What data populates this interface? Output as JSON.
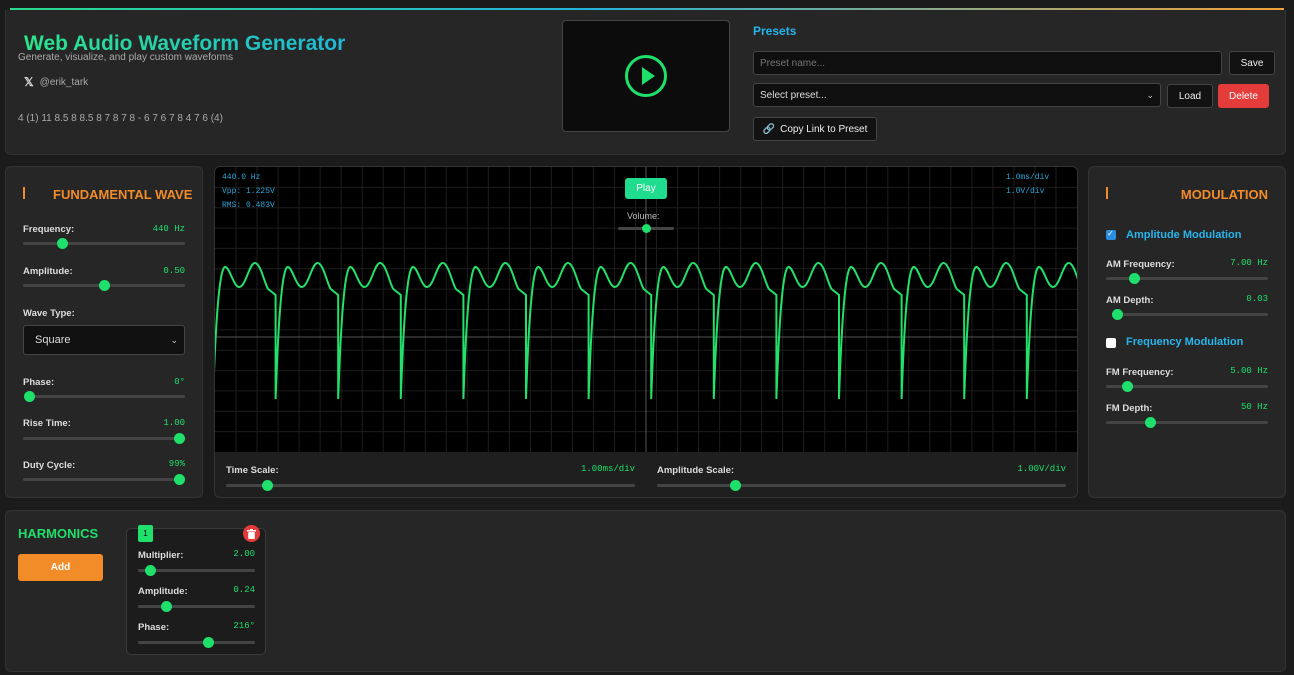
{
  "header": {
    "title": "Web Audio Waveform Generator",
    "subtitle": "Generate, visualize, and play custom waveforms",
    "social_handle": "@erik_tark",
    "ratings": "4 (1) 11 8.5 8 8.5 8 7 8 7 8 - 6 7 6 7 8 4 7 6 (4)"
  },
  "presets": {
    "title": "Presets",
    "name_placeholder": "Preset name...",
    "save_label": "Save",
    "select_value": "Select preset...",
    "load_label": "Load",
    "delete_label": "Delete",
    "copy_link_label": "Copy Link to Preset"
  },
  "fundamental": {
    "title": "FUNDAMENTAL WAVE",
    "frequency": {
      "label": "Frequency:",
      "value": "440 Hz",
      "level": 0.24
    },
    "amplitude": {
      "label": "Amplitude:",
      "value": "0.50",
      "level": 0.5
    },
    "wave_type": {
      "label": "Wave Type:",
      "value": "Square"
    },
    "phase": {
      "label": "Phase:",
      "value": "0°",
      "level": 0.0
    },
    "rise_time": {
      "label": "Rise Time:",
      "value": "1.00",
      "level": 1.0
    },
    "duty_cycle": {
      "label": "Duty Cycle:",
      "value": "99%",
      "level": 1.0
    }
  },
  "scope": {
    "freq_readout": "440.0 Hz",
    "vpp_readout": "Vpp: 1.225V",
    "rms_readout": "RMS: 0.483V",
    "time_div_readout": "1.0ms/div",
    "volt_div_readout": "1.0V/div",
    "play_label": "Play",
    "volume_label": "Volume:",
    "volume_level": 0.5,
    "time_scale": {
      "label": "Time Scale:",
      "value": "1.00ms/div",
      "level": 0.1
    },
    "amplitude_scale": {
      "label": "Amplitude Scale:",
      "value": "1.00V/div",
      "level": 0.19
    }
  },
  "modulation": {
    "title": "MODULATION",
    "am": {
      "label": "Amplitude Modulation",
      "checked": true
    },
    "am_frequency": {
      "label": "AM Frequency:",
      "value": "7.00 Hz",
      "level": 0.17
    },
    "am_depth": {
      "label": "AM Depth:",
      "value": "0.03",
      "level": 0.03
    },
    "fm": {
      "label": "Frequency Modulation",
      "checked": false
    },
    "fm_frequency": {
      "label": "FM Frequency:",
      "value": "5.00 Hz",
      "level": 0.13
    },
    "fm_depth": {
      "label": "FM Depth:",
      "value": "50 Hz",
      "level": 0.27
    }
  },
  "harmonics": {
    "title": "HARMONICS",
    "add_label": "Add",
    "items": [
      {
        "index": "1",
        "multiplier": {
          "label": "Multiplier:",
          "value": "2.00",
          "level": 0.1
        },
        "amplitude": {
          "label": "Amplitude:",
          "value": "0.24",
          "level": 0.24
        },
        "phase": {
          "label": "Phase:",
          "value": "216°",
          "level": 0.6
        }
      }
    ]
  },
  "colors": {
    "accent_green": "#1ee06b",
    "accent_orange": "#f28c28",
    "accent_blue": "#26b5ea",
    "danger": "#e43b3b"
  }
}
